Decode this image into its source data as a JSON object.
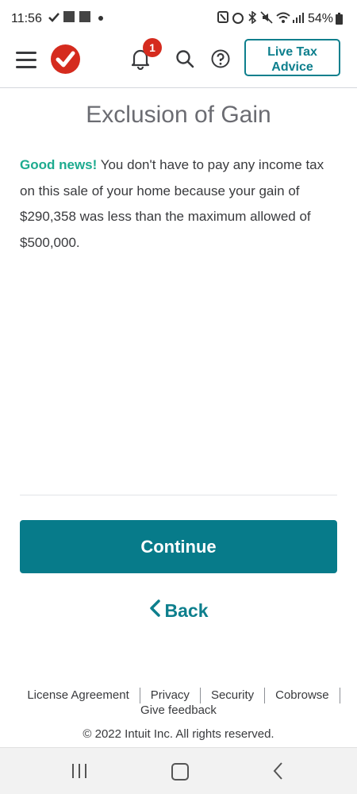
{
  "status_bar": {
    "time": "11:56",
    "battery": "54%"
  },
  "header": {
    "notification_count": "1",
    "live_tax_line1": "Live Tax",
    "live_tax_line2": "Advice",
    "brand_color": "#d52b1e",
    "accent_color": "#0d7f8d"
  },
  "main": {
    "title": "Exclusion of Gain",
    "good_news": "Good news!",
    "message": " You don't have to pay any income tax on this sale of your home because your gain of $290,358 was less than the maximum allowed of $500,000."
  },
  "actions": {
    "continue_label": "Continue",
    "back_label": "Back"
  },
  "footer": {
    "links": [
      "License Agreement",
      "Privacy",
      "Security",
      "Cobrowse"
    ],
    "feedback": "Give feedback",
    "copyright": "© 2022 Intuit Inc. All rights reserved."
  }
}
